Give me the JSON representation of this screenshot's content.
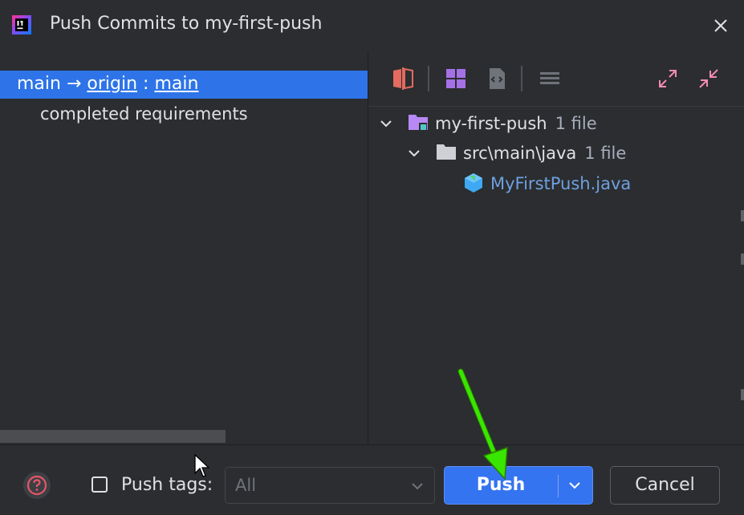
{
  "window": {
    "title": "Push Commits to my-first-push",
    "app_icon": "intellij-icon",
    "close_icon": "close-icon"
  },
  "push_target": {
    "local_branch": "main",
    "arrow": "→",
    "remote": "origin",
    "separator": ":",
    "remote_branch": "main"
  },
  "commits": [
    {
      "message": "completed requirements"
    }
  ],
  "toolbar": {
    "icons": [
      "diff-icon",
      "group-by-icon",
      "file-source-icon",
      "list-icon",
      "expand-all-icon",
      "collapse-all-icon"
    ]
  },
  "tree": {
    "repo": {
      "name": "my-first-push",
      "count": "1 file"
    },
    "folder": {
      "name": "src\\main\\java",
      "count": "1 file"
    },
    "file": {
      "name": "MyFirstPush.java"
    }
  },
  "footer": {
    "help_icon": "help-icon",
    "push_tags_label": "Push tags:",
    "push_tags_checked": false,
    "tags_select_value": "All",
    "push_label": "Push",
    "cancel_label": "Cancel"
  },
  "colors": {
    "background": "#2b2d30",
    "selection": "#2e74e8",
    "primary_button": "#3574f0",
    "file_link": "#6fa0df",
    "annotation_arrow": "#39e600"
  }
}
